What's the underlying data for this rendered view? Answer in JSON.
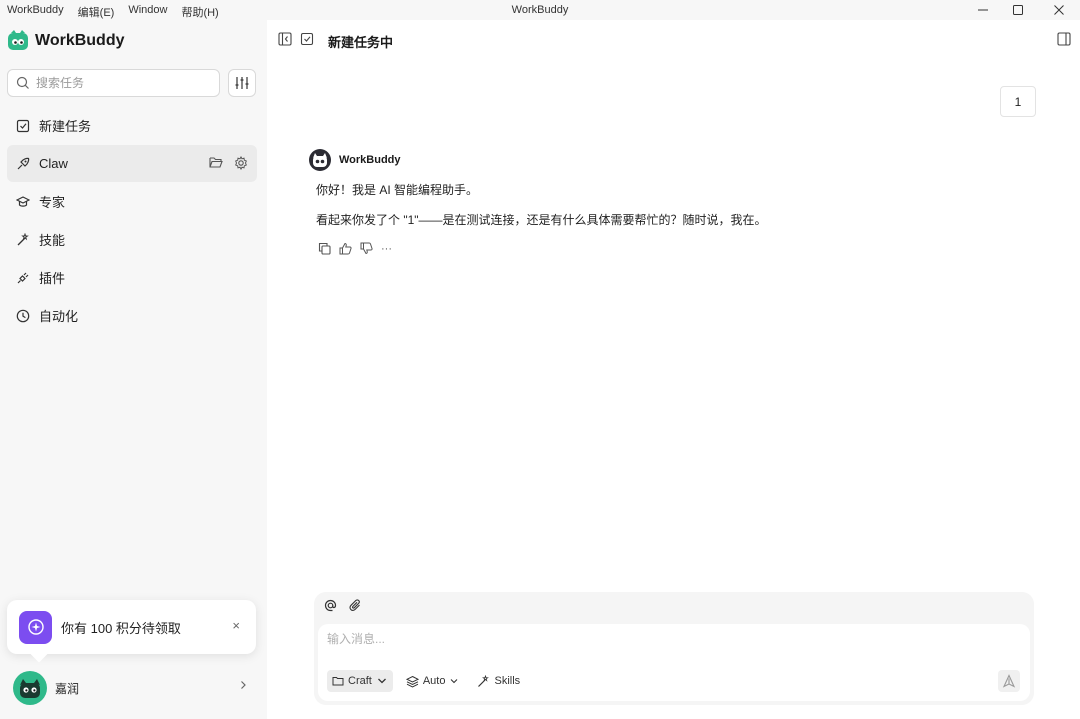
{
  "window": {
    "title": "WorkBuddy",
    "menu": [
      "WorkBuddy",
      "编辑(E)",
      "Window",
      "帮助(H)"
    ]
  },
  "sidebar": {
    "app_name": "WorkBuddy",
    "search_placeholder": "搜索任务",
    "items": [
      {
        "label": "新建任务",
        "icon": "new-task-icon"
      },
      {
        "label": "Claw",
        "icon": "claw-icon"
      },
      {
        "label": "专家",
        "icon": "graduation-cap-icon"
      },
      {
        "label": "技能",
        "icon": "magic-wand-icon"
      },
      {
        "label": "插件",
        "icon": "plug-icon"
      },
      {
        "label": "自动化",
        "icon": "clock-icon"
      }
    ]
  },
  "toast": {
    "text": "你有 100 积分待领取",
    "close": "×"
  },
  "user": {
    "name": "嘉润"
  },
  "main": {
    "page_title": "新建任务中",
    "user_message": "1",
    "assistant": {
      "name": "WorkBuddy",
      "lines": [
        "你好！我是 AI 智能编程助手。",
        "看起来你发了个 \"1\"——是在测试连接，还是有什么具体需要帮忙的？随时说，我在。"
      ],
      "more": "···"
    }
  },
  "composer": {
    "placeholder": "输入消息...",
    "mode_label": "Craft",
    "model_label": "Auto",
    "skills_label": "Skills"
  },
  "colors": {
    "sidebar_bg": "#f7f7f7",
    "accent_purple": "#7c4df0",
    "logo_green": "#2fb98a"
  }
}
